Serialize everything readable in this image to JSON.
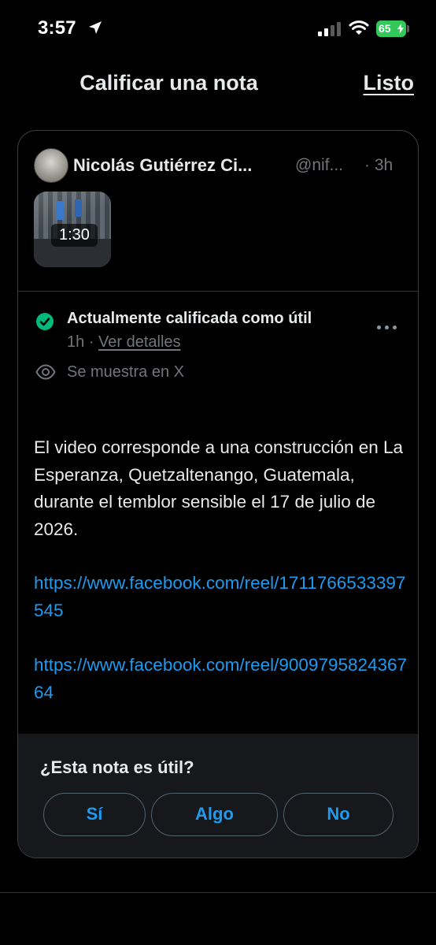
{
  "status_bar": {
    "time": "3:57",
    "battery": "65"
  },
  "header": {
    "title": "Calificar una nota",
    "done_label": "Listo"
  },
  "post": {
    "author": "Nicolás Gutiérrez Ci...",
    "handle": "@nif...",
    "time": "· 3h",
    "video_duration": "1:30"
  },
  "note": {
    "status": "Actualmente calificada como útil",
    "age": "1h",
    "separator": "·",
    "details_link": "Ver detalles",
    "shown_on": "Se muestra en X",
    "body": "El video corresponde a una construcción en La Esperanza, Quetzaltenango, Guatemala, durante el temblor sensible el 17 de julio de 2026.",
    "links": [
      "https://www.facebook.com/reel/1711766533397545",
      "https://www.facebook.com/reel/900979582436764"
    ]
  },
  "rating": {
    "question": "¿Esta nota es útil?",
    "options": [
      "Sí",
      "Algo",
      "No"
    ]
  },
  "colors": {
    "accent": "#1d9bf0",
    "success": "#00ba7c",
    "battery": "#34c759"
  },
  "icons": [
    "location-arrow-icon",
    "cellular-signal-icon",
    "wifi-icon",
    "battery-icon",
    "check-circle-icon",
    "more-icon",
    "eye-icon"
  ]
}
